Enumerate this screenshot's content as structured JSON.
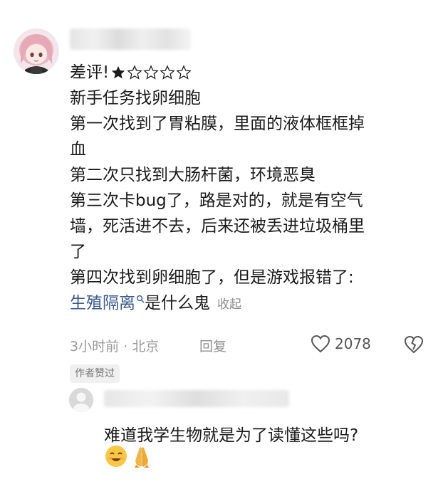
{
  "comment": {
    "rating_label": "差评!",
    "rating_stars": 1,
    "rating_max": 5,
    "lines": [
      "新手任务找卵细胞",
      "第一次找到了胃粘膜，里面的液体框框掉",
      "血",
      "第二次只找到大肠杆菌，环境恶臭",
      "第三次卡bug了，路是对的，就是有空气",
      "墙，死活进不去，后来还被丢进垃圾桶里",
      "了",
      "第四次找到卵细胞了，但是游戏报错了:"
    ],
    "tag_link": "生殖隔离",
    "tag_suffix": "是什么鬼",
    "collapse_label": "收起"
  },
  "meta": {
    "time_location": "3小时前 · 北京",
    "reply_label": "回复",
    "like_count": "2078"
  },
  "author_liked_badge": "作者赞过",
  "reply": {
    "text": "难道我学生物就是为了读懂这些吗?",
    "emoji_names": [
      "smiling-face-icon",
      "folded-hands-icon"
    ]
  },
  "colors": {
    "link": "#3a5a8c",
    "meta_gray": "#9a9a9a",
    "star": "#1b1b1b"
  }
}
